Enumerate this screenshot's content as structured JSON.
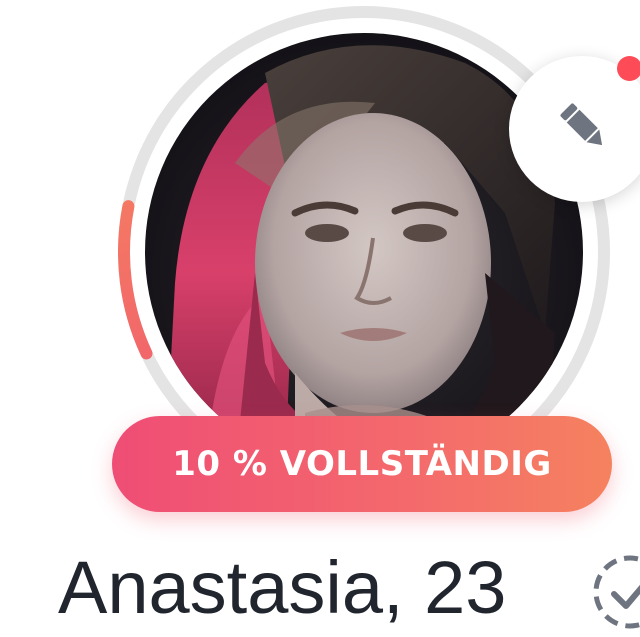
{
  "profile": {
    "name_age": "Anastasia, 23",
    "completion_label": "10 % VOLLSTÄNDIG",
    "completion_percent": 10
  },
  "colors": {
    "accent_pink": "#ef4d75",
    "accent_orange": "#f5825f",
    "notification_red": "#fd4c58",
    "ring_track": "#e4e4e4",
    "icon_gray": "#6e7580",
    "text_dark": "#21262e"
  },
  "icons": {
    "edit": "pencil-icon",
    "verify": "verified-check-icon"
  }
}
